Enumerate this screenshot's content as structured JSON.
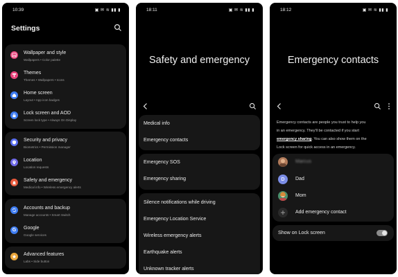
{
  "screen1": {
    "time": "10:39",
    "title": "Settings",
    "groups": [
      [
        {
          "icon": "image-icon",
          "color": "#e8437b",
          "title": "Wallpaper and style",
          "subtitle": "Wallpapers  •  Color palette"
        },
        {
          "icon": "palette-icon",
          "color": "#e8437b",
          "title": "Themes",
          "subtitle": "Themes  •  Wallpapers  •  Icons"
        },
        {
          "icon": "home-icon",
          "color": "#3f7df2",
          "title": "Home screen",
          "subtitle": "Layout  •  App icon badges"
        },
        {
          "icon": "lock-screen-icon",
          "color": "#3f7df2",
          "title": "Lock screen and AOD",
          "subtitle": "Screen lock type  •  Always On Display"
        }
      ],
      [
        {
          "icon": "shield-icon",
          "color": "#5a6ff0",
          "title": "Security and privacy",
          "subtitle": "Biometrics  •  Permission manager"
        },
        {
          "icon": "location-icon",
          "color": "#6f6ae8",
          "title": "Location",
          "subtitle": "Location requests"
        },
        {
          "icon": "siren-icon",
          "color": "#e8593b",
          "title": "Safety and emergency",
          "subtitle": "Medical info  •  Wireless emergency alerts"
        }
      ],
      [
        {
          "icon": "sync-icon",
          "color": "#3f7df2",
          "title": "Accounts and backup",
          "subtitle": "Manage accounts  •  Smart Switch"
        },
        {
          "icon": "google-icon",
          "color": "#3f7df2",
          "title": "Google",
          "subtitle": "Google services"
        }
      ],
      [
        {
          "icon": "star-icon",
          "color": "#e8a53b",
          "title": "Advanced features",
          "subtitle": "Labs  •  Side button"
        }
      ]
    ]
  },
  "screen2": {
    "time": "18:11",
    "title": "Safety and emergency",
    "groups": [
      [
        "Medical info",
        "Emergency contacts"
      ],
      [
        "Emergency SOS",
        "Emergency sharing"
      ],
      [
        "Silence notifications while driving",
        "Emergency Location Service",
        "Wireless emergency alerts",
        "Earthquake alerts",
        "Unknown tracker alerts"
      ]
    ]
  },
  "screen3": {
    "time": "18:12",
    "title": "Emergency contacts",
    "intro_line1": "Emergency contacts are people you trust to help you",
    "intro_line2": "in an emergency. They'll be contacted if you start",
    "intro_highlight": "emergency sharing",
    "intro_line3_rest": ". You can also show them on the",
    "intro_line4": "Lock screen for quick access in an emergency.",
    "contacts": [
      {
        "name": "Marcus",
        "blurred": true
      },
      {
        "name": "Dad",
        "blurred": false
      },
      {
        "name": "Mom",
        "blurred": false
      }
    ],
    "add_label": "Add emergency contact",
    "lock_screen_label": "Show on Lock screen",
    "lock_screen_enabled": true
  },
  "colors": {
    "background": "#000000",
    "card": "#171717",
    "text": "#ededed",
    "subtext": "#9a9a9a"
  }
}
